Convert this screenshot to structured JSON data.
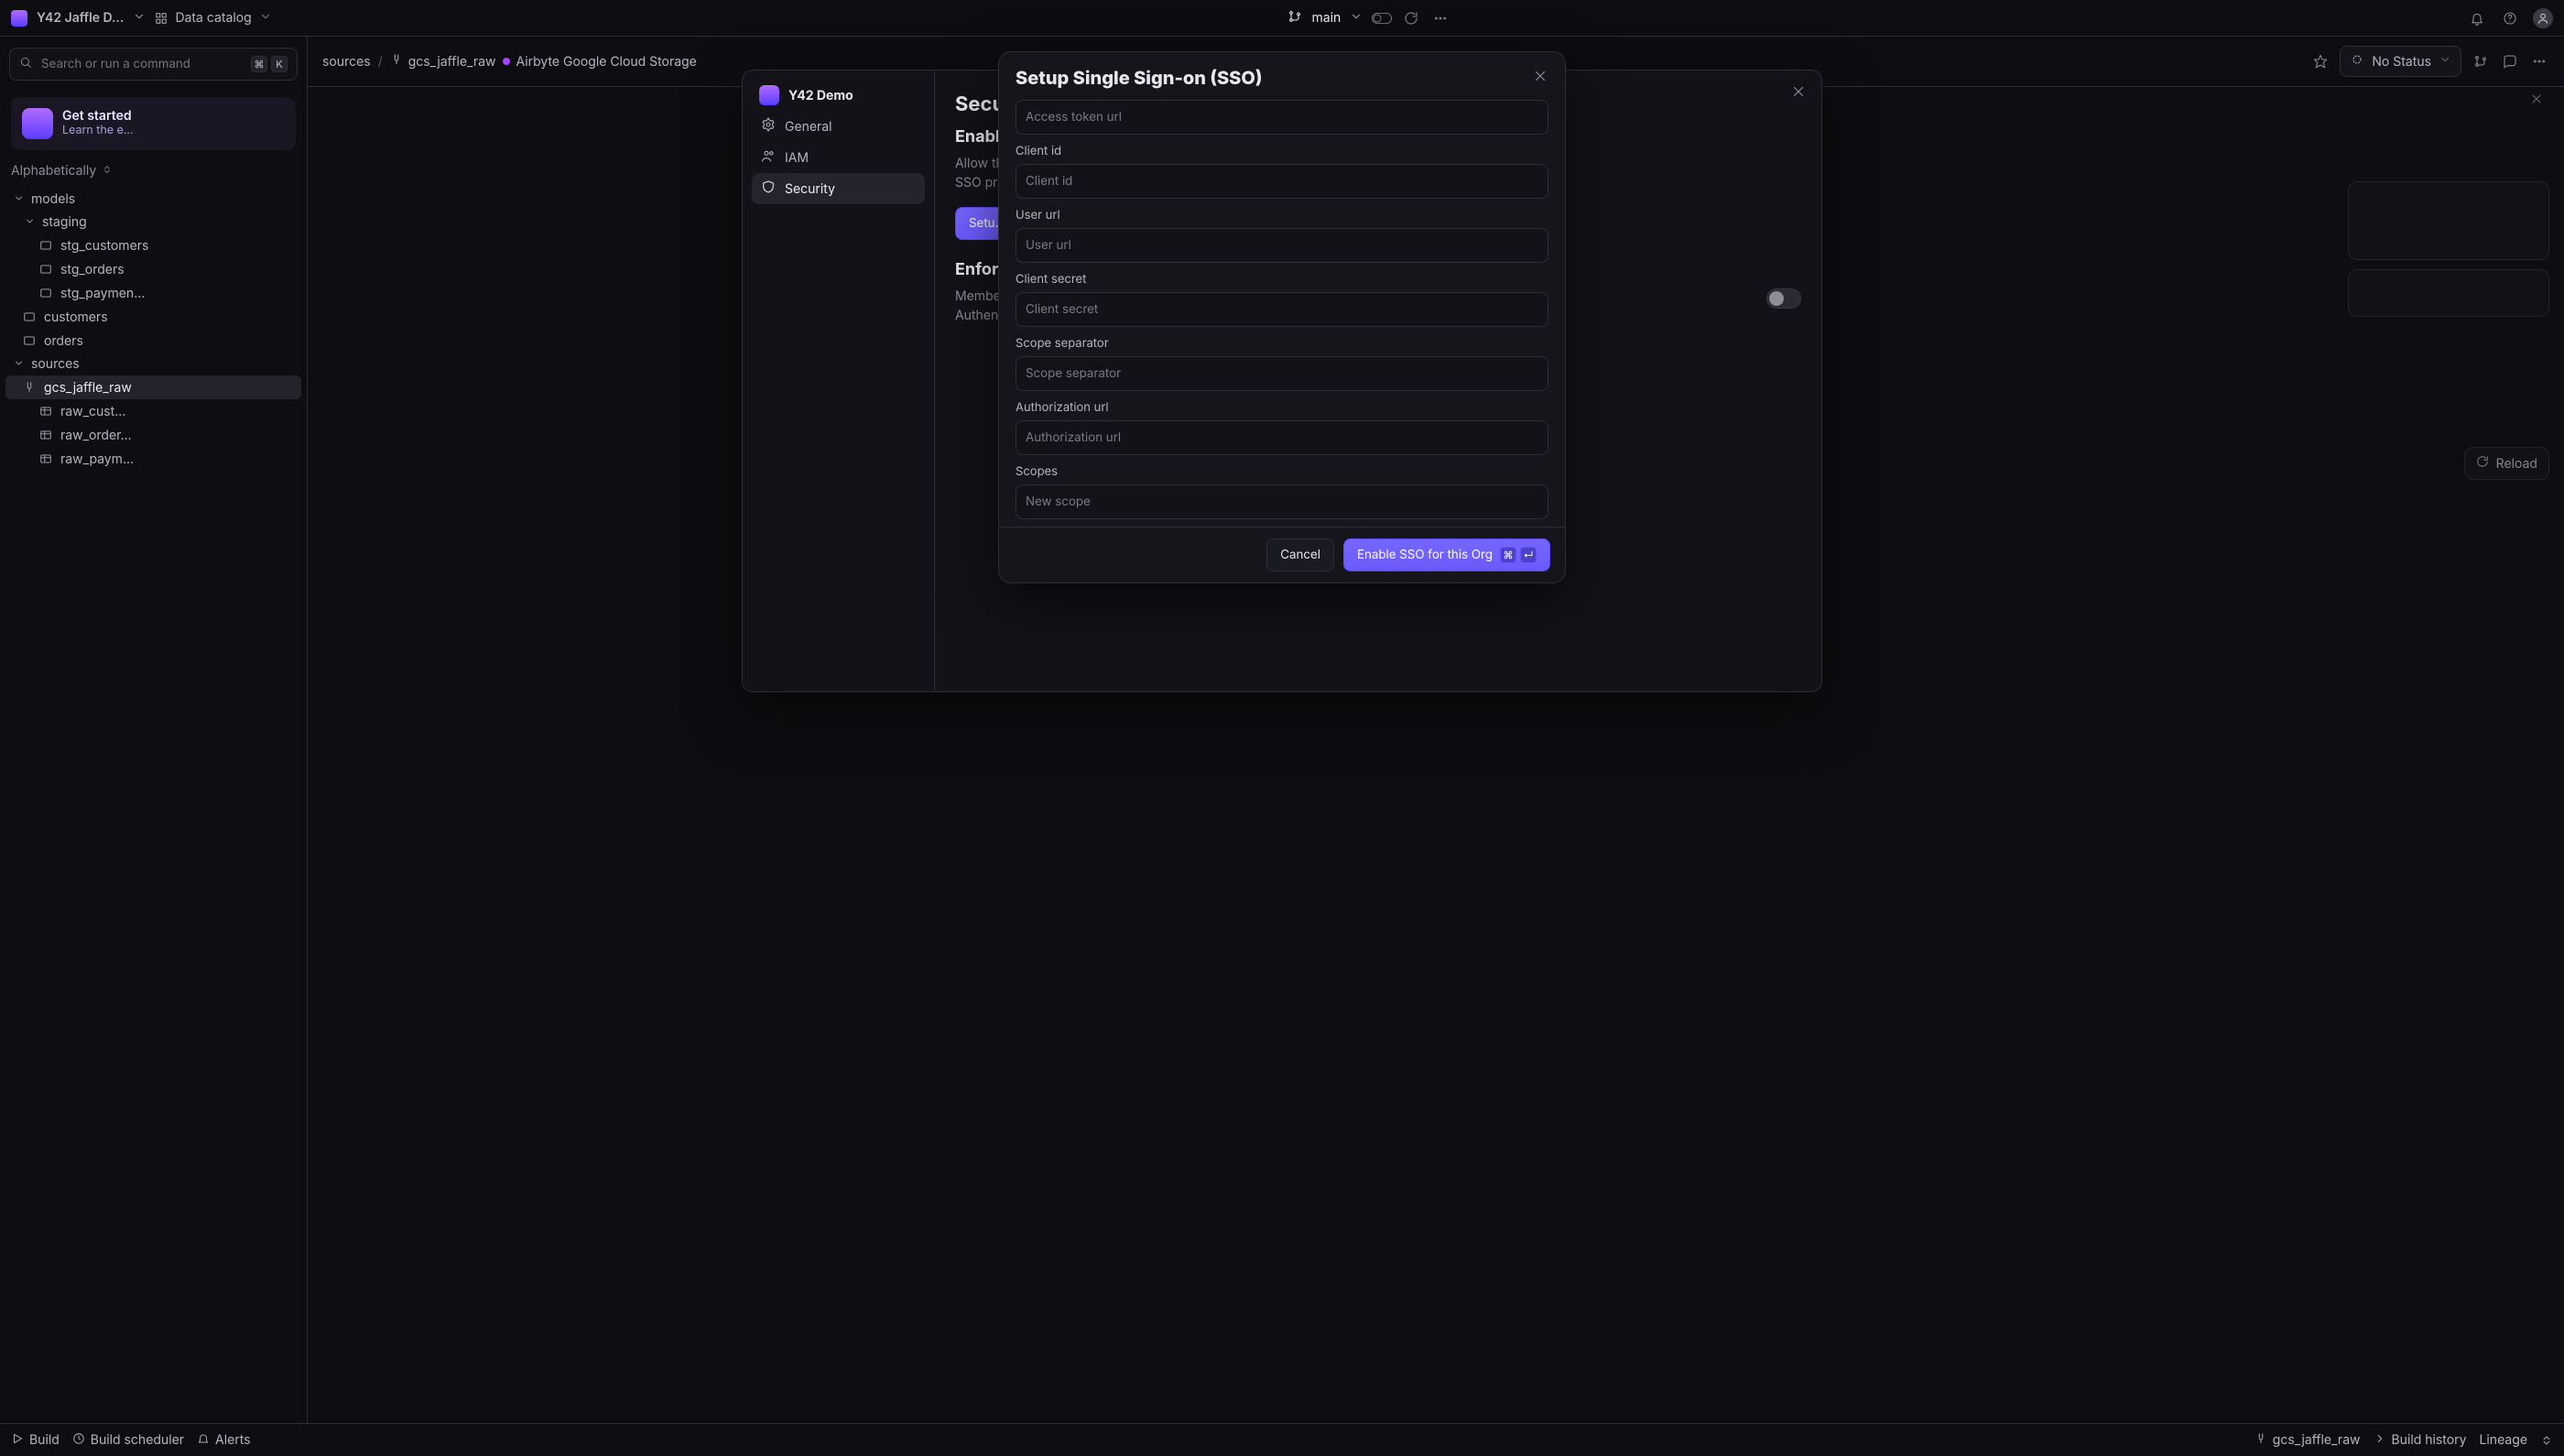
{
  "top": {
    "project_name": "Y42 Jaffle D…",
    "catalog_label": "Data catalog",
    "branch_label": "main"
  },
  "search": {
    "placeholder": "Search or run a command",
    "kbd": {
      "k1": "⌘",
      "k2": "K"
    }
  },
  "starter": {
    "title": "Get started",
    "subtitle": "Learn the e…"
  },
  "listhead": "Alphabetically",
  "tree": {
    "models": {
      "label": "models"
    },
    "staging": {
      "label": "staging"
    },
    "staging_items": [
      {
        "label": "stg_customers"
      },
      {
        "label": "stg_orders"
      },
      {
        "label": "stg_paymen…"
      }
    ],
    "models_items": [
      {
        "label": "customers"
      },
      {
        "label": "orders"
      }
    ],
    "sources": {
      "label": "sources"
    },
    "source_sel": {
      "label": "gcs_jaffle_raw"
    },
    "source_children": [
      {
        "label": "raw_cust…"
      },
      {
        "label": "raw_order…"
      },
      {
        "label": "raw_paym…"
      }
    ]
  },
  "crumbs": {
    "first": "sources",
    "sep": "/",
    "second": "gcs_jaffle_raw",
    "third": "Airbyte Google Cloud Storage"
  },
  "status": {
    "label": "No Status"
  },
  "reload": {
    "label": "Reload"
  },
  "settings": {
    "org_name": "Y42 Demo",
    "nav": {
      "general": "General",
      "iam": "IAM",
      "security": "Security"
    },
    "page_title": "Security",
    "enable": {
      "title": "Enable SSO",
      "desc1": "Allow th…",
      "desc2": "SSO pr…"
    },
    "setup_button": "Setu…",
    "enforce": {
      "title": "Enforce SSO",
      "desc1": "Member…",
      "desc2": "Authent…"
    }
  },
  "modal": {
    "title": "Setup Single Sign-on (SSO)",
    "fields": {
      "access_token": {
        "placeholder": "Access token url"
      },
      "client_id_label": "Client id",
      "client_id": {
        "placeholder": "Client id"
      },
      "user_url_label": "User url",
      "user_url": {
        "placeholder": "User url"
      },
      "client_secret_label": "Client secret",
      "client_secret": {
        "placeholder": "Client secret"
      },
      "scope_sep_label": "Scope separator",
      "scope_sep": {
        "placeholder": "Scope separator"
      },
      "auth_url_label": "Authorization url",
      "auth_url": {
        "placeholder": "Authorization url"
      },
      "scopes_label": "Scopes",
      "scopes": {
        "placeholder": "New scope"
      }
    },
    "buttons": {
      "cancel": "Cancel",
      "submit": "Enable SSO for this Org",
      "kbd": {
        "k1": "⌘",
        "k2": "↵"
      }
    }
  },
  "footer": {
    "build": "Build",
    "scheduler": "Build scheduler",
    "alerts": "Alerts",
    "history": "Build history",
    "lineage": "Lineage",
    "source_name": "gcs_jaffle_raw"
  }
}
